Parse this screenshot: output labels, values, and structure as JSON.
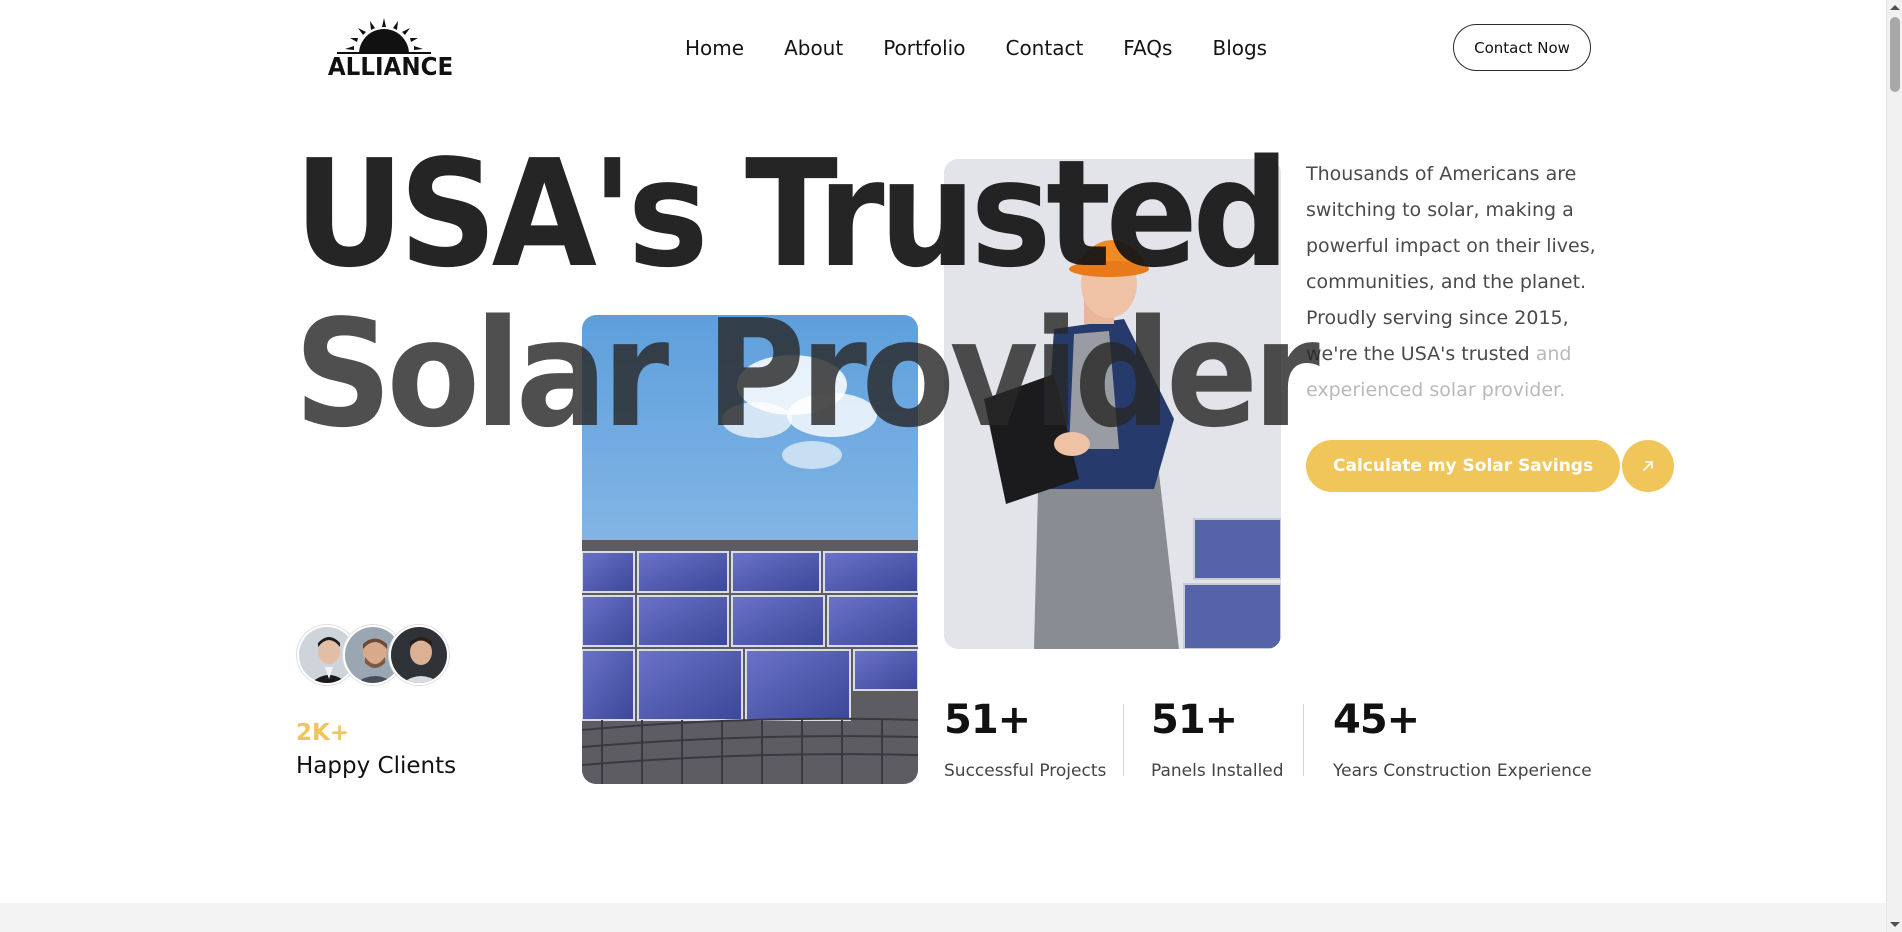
{
  "header": {
    "logo_text": "ALLIANCE",
    "nav": [
      "Home",
      "About",
      "Portfolio",
      "Contact",
      "FAQs",
      "Blogs"
    ],
    "contact_button": "Contact Now"
  },
  "hero": {
    "title_line_1": "USA's Trusted",
    "title_line_2": "Solar Provider",
    "description_main": "Thousands of Americans are switching to solar, making a powerful impact on their lives, communities, and the planet. Proudly serving since 2015, we're the USA's trusted",
    "description_fade": "and experienced solar provider.",
    "cta_label": "Calculate my Solar Savings",
    "cta_icon": "arrow-up-right-icon"
  },
  "clients": {
    "count": "2K+",
    "label": "Happy Clients"
  },
  "stats": [
    {
      "value": "51+",
      "label": "Successful Projects"
    },
    {
      "value": "51+",
      "label": "Panels Installed"
    },
    {
      "value": "45+",
      "label": "Years Construction Experience"
    }
  ],
  "colors": {
    "accent": "#f0c55a",
    "text": "#111111",
    "muted": "#4a4a4a"
  }
}
